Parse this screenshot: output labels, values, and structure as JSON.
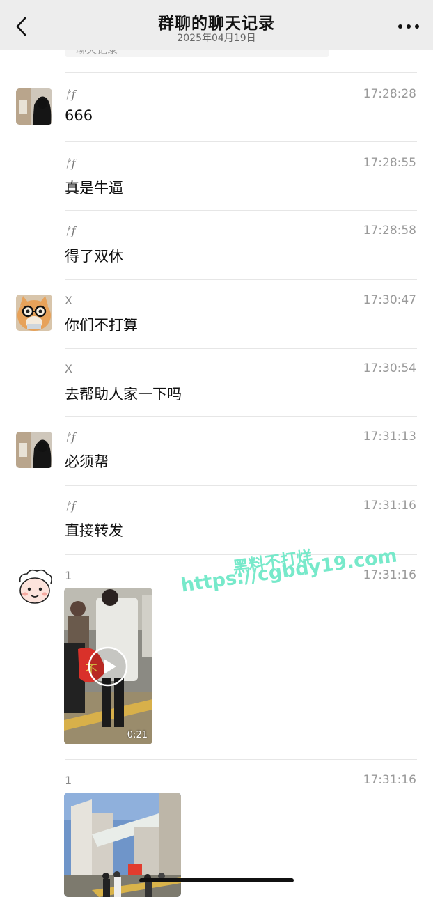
{
  "header": {
    "title": "群聊的聊天记录",
    "date": "2025年04月19日"
  },
  "previous_card": {
    "label": "聊天记录"
  },
  "messages": [
    {
      "sender": "ᚨf",
      "time": "17:28:28",
      "text": "666",
      "avatar": "hooded-person-avatar"
    },
    {
      "sender": "ᚨf",
      "time": "17:28:55",
      "text": "真是牛逼"
    },
    {
      "sender": "ᚨf",
      "time": "17:28:58",
      "text": "得了双休"
    },
    {
      "sender": "X",
      "time": "17:30:47",
      "text": "你们不打算",
      "avatar": "cat-with-glasses-avatar"
    },
    {
      "sender": "X",
      "time": "17:30:54",
      "text": "去帮助人家一下吗"
    },
    {
      "sender": "ᚨf",
      "time": "17:31:13",
      "text": "必须帮",
      "avatar": "hooded-person-avatar"
    },
    {
      "sender": "ᚨf",
      "time": "17:31:16",
      "text": "直接转发"
    },
    {
      "sender": "1",
      "time": "17:31:16",
      "avatar": "cartoon-face-avatar",
      "video_duration": "0:21"
    },
    {
      "sender": "1",
      "time": "17:31:16",
      "media": "photo"
    }
  ],
  "watermark": {
    "line1": "黑料不打烊",
    "line2": "https://cgbdy19.com"
  },
  "colors": {
    "header_bg": "#ededed",
    "watermark": "#64e6c3"
  }
}
